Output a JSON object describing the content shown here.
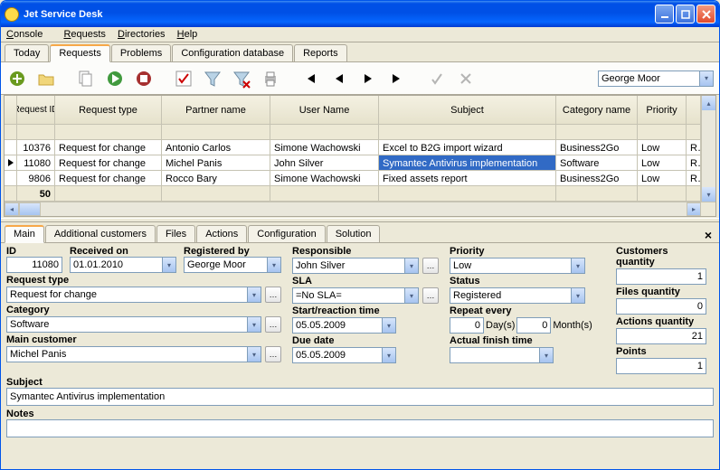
{
  "window": {
    "title": "Jet Service Desk"
  },
  "menu": {
    "console": "Console",
    "requests": "Requests",
    "directories": "Directories",
    "help": "Help"
  },
  "top_tabs": {
    "today": "Today",
    "requests": "Requests",
    "problems": "Problems",
    "configdb": "Configuration database",
    "reports": "Reports",
    "active": "requests"
  },
  "toolbar": {
    "user_filter": "George Moor"
  },
  "grid": {
    "headers": {
      "id": "Request ID",
      "type": "Request type",
      "partner": "Partner name",
      "user": "User Name",
      "subject": "Subject",
      "category": "Category name",
      "priority": "Priority"
    },
    "rows": [
      {
        "id": "10376",
        "type": "Request for change",
        "partner": "Antonio Carlos",
        "user": "Simone Wachowski",
        "subject": "Excel to B2G import wizard",
        "category": "Business2Go",
        "priority": "Low",
        "rest": "R"
      },
      {
        "id": "11080",
        "type": "Request for change",
        "partner": "Michel Panis",
        "user": "John Silver",
        "subject": "Symantec Antivirus implementation",
        "category": "Software",
        "priority": "Low",
        "rest": "R",
        "current": true,
        "selectCell": "subject"
      },
      {
        "id": "9806",
        "type": "Request for change",
        "partner": "Rocco Bary",
        "user": "Simone Wachowski",
        "subject": "Fixed assets report",
        "category": "Business2Go",
        "priority": "Low",
        "rest": "R"
      }
    ],
    "footer_count": "50"
  },
  "detail_tabs": {
    "main": "Main",
    "addcust": "Additional customers",
    "files": "Files",
    "actions": "Actions",
    "configuration": "Configuration",
    "solution": "Solution"
  },
  "form": {
    "id": {
      "label": "ID",
      "value": "11080"
    },
    "received": {
      "label": "Received on",
      "value": "01.01.2010"
    },
    "registered_by": {
      "label": "Registered by",
      "value": "George Moor"
    },
    "request_type": {
      "label": "Request type",
      "value": "Request for change"
    },
    "category": {
      "label": "Category",
      "value": "Software"
    },
    "main_customer": {
      "label": "Main customer",
      "value": "Michel Panis"
    },
    "responsible": {
      "label": "Responsible",
      "value": "John Silver"
    },
    "sla": {
      "label": "SLA",
      "value": "=No SLA="
    },
    "start": {
      "label": "Start/reaction time",
      "value": "05.05.2009"
    },
    "due": {
      "label": "Due date",
      "value": "05.05.2009"
    },
    "priority": {
      "label": "Priority",
      "value": "Low"
    },
    "status": {
      "label": "Status",
      "value": "Registered"
    },
    "repeat": {
      "label": "Repeat every",
      "days": "0",
      "days_u": "Day(s)",
      "months": "0",
      "months_u": "Month(s)"
    },
    "actual_finish": {
      "label": "Actual finish time",
      "value": ""
    },
    "cust_qty": {
      "label": "Customers quantity",
      "value": "1"
    },
    "files_qty": {
      "label": "Files quantity",
      "value": "0"
    },
    "actions_qty": {
      "label": "Actions quantity",
      "value": "21"
    },
    "points": {
      "label": "Points",
      "value": "1"
    },
    "subject": {
      "label": "Subject",
      "value": "Symantec Antivirus implementation"
    },
    "notes": {
      "label": "Notes",
      "value": ""
    }
  }
}
